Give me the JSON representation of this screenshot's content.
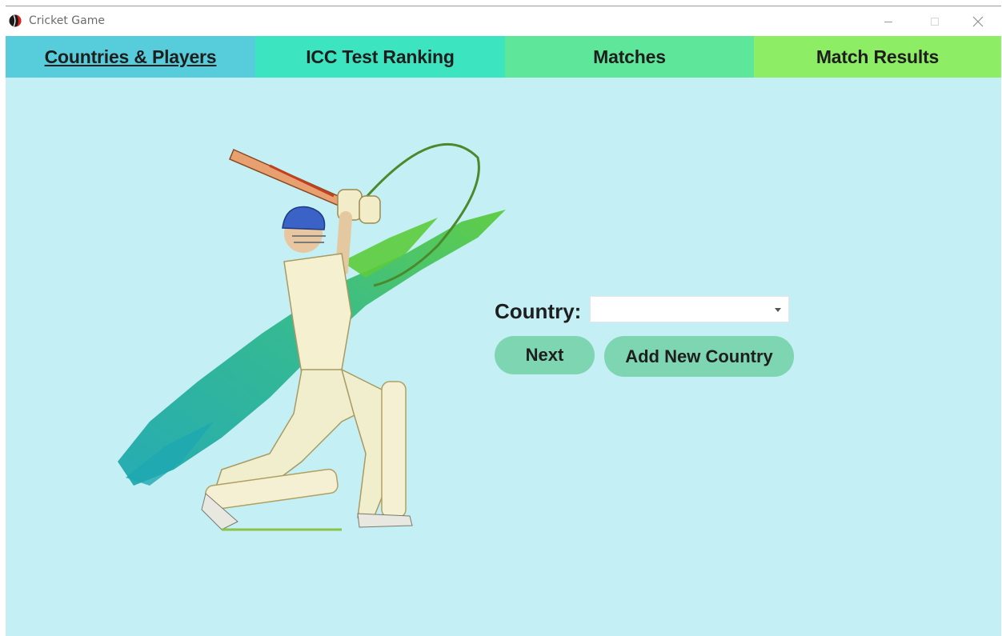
{
  "window": {
    "title": "Cricket Game",
    "icon": "cricket-ball-icon",
    "controls": [
      "minimize-icon",
      "maximize-icon",
      "close-icon"
    ]
  },
  "tabs": [
    {
      "label": "Countries & Players",
      "active": true,
      "color": "#57cddb"
    },
    {
      "label": "ICC Test Ranking",
      "active": false,
      "color": "#3de4c0"
    },
    {
      "label": "Matches",
      "active": false,
      "color": "#5ee79a"
    },
    {
      "label": "Match Results",
      "active": false,
      "color": "#8ded65"
    }
  ],
  "form": {
    "country_label": "Country:",
    "country_value": "",
    "next_label": "Next",
    "add_country_label": "Add New Country"
  },
  "colors": {
    "background": "#c4eff4",
    "button": "#7ed5b1"
  }
}
